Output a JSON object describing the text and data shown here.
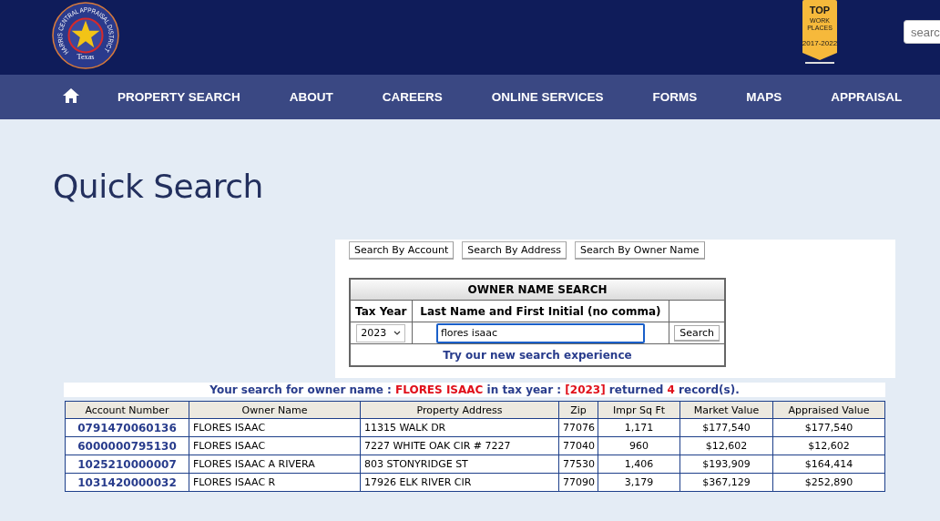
{
  "header": {
    "logo_text": "HARRIS CENTRAL APPRAISAL DISTRICT",
    "logo_state": "Texas",
    "badge": {
      "top": "TOP",
      "lines": [
        "WORK",
        "PLACES"
      ],
      "years": "2017-2022"
    },
    "search": {
      "placeholder": "searc"
    }
  },
  "nav": {
    "items": [
      "PROPERTY SEARCH",
      "ABOUT",
      "CAREERS",
      "ONLINE SERVICES",
      "FORMS",
      "MAPS",
      "APPRAISAL"
    ]
  },
  "page_title": "Quick Search",
  "search_tabs": [
    "Search By Account",
    "Search By Address",
    "Search By Owner Name"
  ],
  "owner_search": {
    "title": "OWNER NAME SEARCH",
    "columns": [
      "Tax Year",
      "Last Name and First Initial (no comma)"
    ],
    "tax_year": "2023",
    "name_value": "flores isaac",
    "button": "Search",
    "link": "Try our new search experience"
  },
  "result_message": [
    {
      "text": "Your search for owner name : ",
      "highlight": false
    },
    {
      "text": "FLORES ISAAC",
      "highlight": true
    },
    {
      "text": " in tax year : ",
      "highlight": false
    },
    {
      "text": "[2023]",
      "highlight": true
    },
    {
      "text": " returned ",
      "highlight": false
    },
    {
      "text": "4",
      "highlight": true
    },
    {
      "text": " record(s).",
      "highlight": false
    }
  ],
  "results": {
    "columns": [
      "Account Number",
      "Owner Name",
      "Property Address",
      "Zip",
      "Impr Sq Ft",
      "Market Value",
      "Appraised Value"
    ],
    "rows": [
      [
        "0791470060136",
        "FLORES ISAAC",
        "11315 WALK DR",
        "77076",
        "1,171",
        "$177,540",
        "$177,540"
      ],
      [
        "6000000795130",
        "FLORES ISAAC",
        "7227 WHITE OAK CIR # 7227",
        "77040",
        "960",
        "$12,602",
        "$12,602"
      ],
      [
        "1025210000007",
        "FLORES ISAAC A RIVERA",
        "803 STONYRIDGE ST",
        "77530",
        "1,406",
        "$193,909",
        "$164,414"
      ],
      [
        "1031420000032",
        "FLORES ISAAC R",
        "17926 ELK RIVER CIR",
        "77090",
        "3,179",
        "$367,129",
        "$252,890"
      ]
    ]
  }
}
